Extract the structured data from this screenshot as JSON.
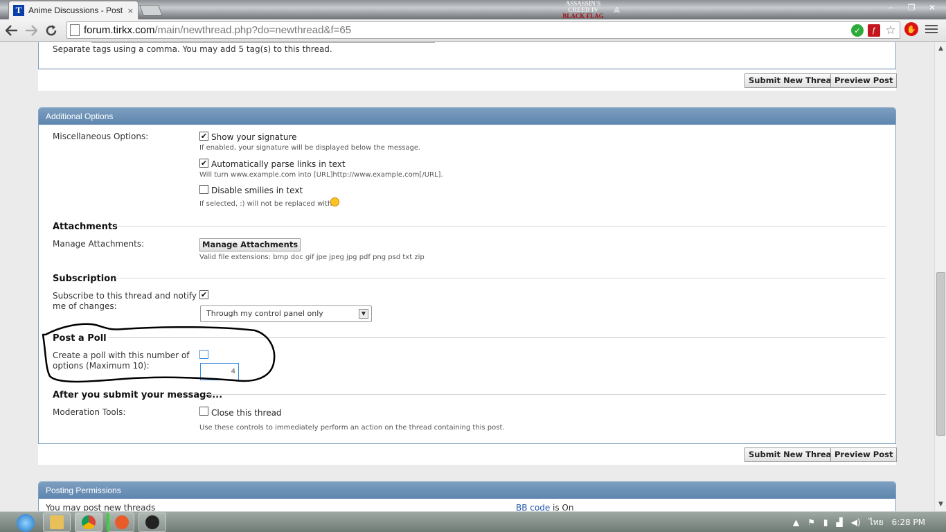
{
  "browser": {
    "tab_title": "Anime Discussions - Post",
    "tab_favicon": "T",
    "tab_close": "×",
    "url_host": "forum.tirkx.com",
    "url_path": "/main/newthread.php?do=newthread&f=65",
    "logo_text_1": "ASSASSIN'S",
    "logo_text_2": "CREED IV",
    "logo_text_3": "BLACK FLAG",
    "window_controls": [
      "–",
      "❐",
      "✕"
    ]
  },
  "tags": {
    "hint": "Separate tags using a comma. You may add 5 tag(s) to this thread."
  },
  "actions": {
    "submit_label": "Submit New Thread",
    "preview_label": "Preview Post"
  },
  "additional_options": {
    "header": "Additional Options",
    "misc_label": "Miscellaneous Options:",
    "show_signature": "Show your signature",
    "show_signature_hint": "If enabled, your signature will be displayed below the message.",
    "parse_links": "Automatically parse links in text",
    "parse_links_hint": "Will turn www.example.com into [URL]http://www.example.com[/URL].",
    "disable_smilies": "Disable smilies in text",
    "disable_smilies_hint": "If selected, :) will not be replaced with",
    "show_signature_checked": "✔",
    "parse_links_checked": "✔",
    "subscribe_checked": "✔"
  },
  "attachments": {
    "title": "Attachments",
    "label": "Manage Attachments:",
    "button": "Manage Attachments",
    "hint": "Valid file extensions: bmp doc gif jpe jpeg jpg pdf png psd txt zip"
  },
  "subscription": {
    "title": "Subscription",
    "label_line1": "Subscribe to this thread and notify",
    "label_line2": "me of changes:",
    "select_value": "Through my control panel only",
    "select_arrow": "▼"
  },
  "poll": {
    "title": "Post a Poll",
    "label_line1": "Create a poll with this number of",
    "label_line2": "options (Maximum 10):",
    "value": "4"
  },
  "after_submit": {
    "title": "After you submit your message...",
    "moderation_label": "Moderation Tools:",
    "close_thread": "Close this thread",
    "hint": "Use these controls to immediately perform an action on the thread containing this post."
  },
  "permissions": {
    "header": "Posting Permissions",
    "left_text": "You may post new threads",
    "right_link": "BB code",
    "right_suffix": " is On"
  },
  "scrollbar": {
    "up": "▲",
    "down": "▼"
  },
  "taskbar": {
    "language": "ไทย",
    "time": "6:28 PM"
  },
  "colors": {
    "header_blue": "#6a8fb5",
    "annotation": "#000000",
    "checkbox_focus": "#3a8be0"
  }
}
